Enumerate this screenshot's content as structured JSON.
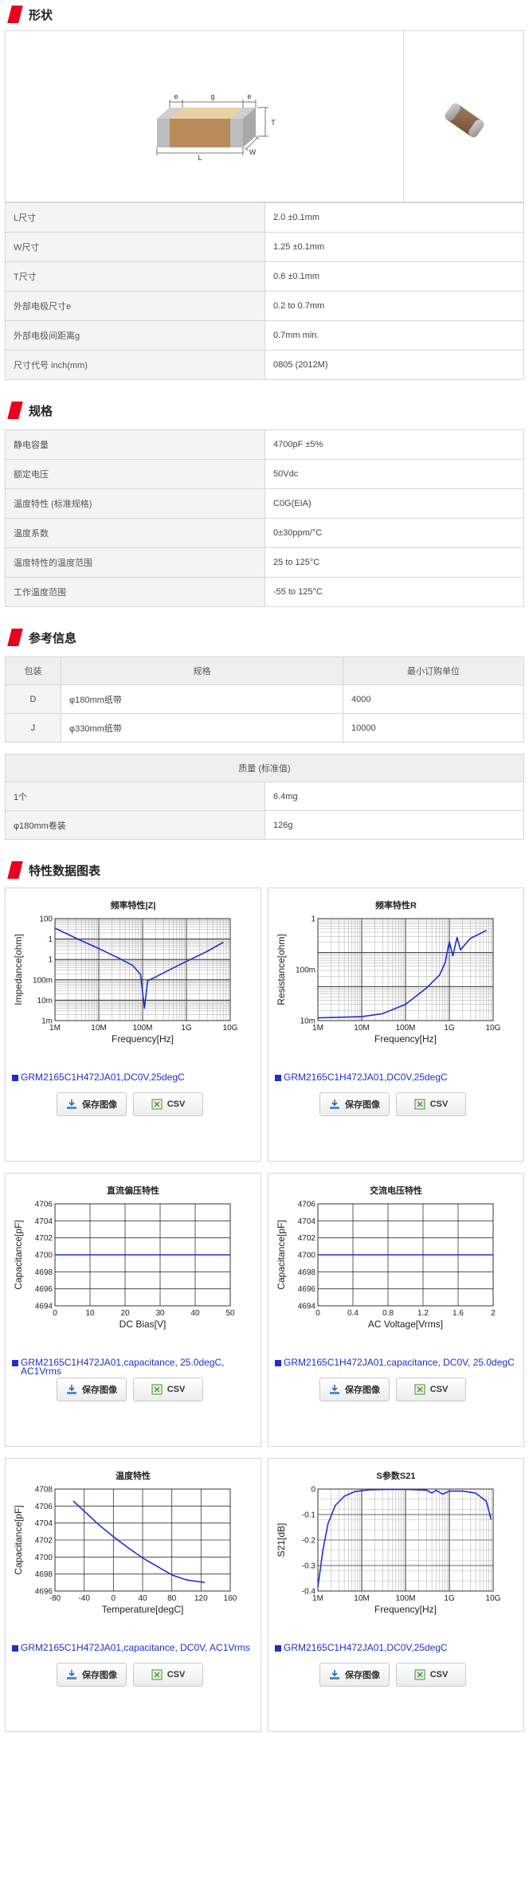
{
  "sections": {
    "shape": "形状",
    "specs": "规格",
    "ref": "参考信息",
    "charts": "特性数据图表"
  },
  "dim_labels": {
    "e": "e",
    "g": "g",
    "t": "T",
    "l": "L",
    "w": "W"
  },
  "shape_table": [
    {
      "k": "L尺寸",
      "v": "2.0 ±0.1mm"
    },
    {
      "k": "W尺寸",
      "v": "1.25 ±0.1mm"
    },
    {
      "k": "T尺寸",
      "v": "0.6 ±0.1mm"
    },
    {
      "k": "外部电极尺寸e",
      "v": "0.2 to 0.7mm"
    },
    {
      "k": "外部电极间距离g",
      "v": "0.7mm min."
    },
    {
      "k": "尺寸代号 inch(mm)",
      "v": "0805 (2012M)"
    }
  ],
  "spec_table": [
    {
      "k": "静电容量",
      "v": "4700pF ±5%"
    },
    {
      "k": "额定电压",
      "v": "50Vdc"
    },
    {
      "k": "温度特性 (标准规格)",
      "v": "C0G(EIA)"
    },
    {
      "k": "温度系数",
      "v": "0±30ppm/°C"
    },
    {
      "k": "温度特性的温度范围",
      "v": "25 to 125°C"
    },
    {
      "k": "工作温度范围",
      "v": "-55 to 125°C"
    }
  ],
  "ref_table": {
    "headers": [
      "包装",
      "规格",
      "最小订购单位"
    ],
    "rows": [
      [
        "D",
        "φ180mm纸带",
        "4000"
      ],
      [
        "J",
        "φ330mm纸带",
        "10000"
      ]
    ]
  },
  "mass_table": {
    "header": "质量 (标准值)",
    "rows": [
      {
        "k": "1个",
        "v": "6.4mg"
      },
      {
        "k": "φ180mm卷装",
        "v": "126g"
      }
    ]
  },
  "buttons": {
    "save": "保存图像",
    "csv": "CSV"
  },
  "colors": {
    "accent": "#e8001d",
    "series": "#1f2fd0"
  },
  "chart_data": [
    {
      "type": "line",
      "title": "频率特性|Z|",
      "xlabel": "Frequency[Hz]",
      "ylabel": "Impedance[ohm]",
      "x_scale": "log",
      "y_scale": "log",
      "xlim": [
        1000000,
        10000000000
      ],
      "ylim": [
        0.001,
        100
      ],
      "x_ticks": [
        "1M",
        "10M",
        "100M",
        "1G",
        "10G"
      ],
      "y_ticks": [
        "100",
        "1",
        "1",
        "100m",
        "10m",
        "1m"
      ],
      "legend": "GRM2165C1H472JA01,DC0V,25degC",
      "series": [
        {
          "name": "GRM2165C1H472JA01,DC0V,25degC",
          "x": [
            1000000,
            3000000,
            10000000,
            30000000,
            60000000,
            90000000,
            110000000,
            130000000,
            200000000,
            400000000,
            1000000000,
            3000000000,
            7000000000
          ],
          "y": [
            34,
            11,
            3.4,
            1.1,
            0.5,
            0.18,
            0.004,
            0.09,
            0.14,
            0.3,
            0.8,
            2.5,
            7
          ]
        }
      ]
    },
    {
      "type": "line",
      "title": "频率特性R",
      "xlabel": "Frequency[Hz]",
      "ylabel": "Resistance[ohm]",
      "x_scale": "log",
      "y_scale": "log",
      "xlim": [
        1000000,
        10000000000
      ],
      "ylim": [
        0.01,
        10
      ],
      "x_ticks": [
        "1M",
        "10M",
        "100M",
        "1G",
        "10G"
      ],
      "y_ticks": [
        "1",
        "100m",
        "10m"
      ],
      "legend": "GRM2165C1H472JA01,DC0V,25degC",
      "series": [
        {
          "name": "GRM2165C1H472JA01,DC0V,25degC",
          "x": [
            1000000,
            10000000,
            30000000,
            100000000,
            300000000,
            600000000,
            800000000,
            1000000000,
            1200000000,
            1500000000,
            1800000000,
            3000000000,
            7000000000
          ],
          "y": [
            0.012,
            0.013,
            0.016,
            0.03,
            0.09,
            0.22,
            0.5,
            2.1,
            0.8,
            2.8,
            1.2,
            2.6,
            4.5
          ]
        }
      ]
    },
    {
      "type": "line",
      "title": "直流偏压特性",
      "xlabel": "DC Bias[V]",
      "ylabel": "Capacitance[pF]",
      "xlim": [
        0,
        50
      ],
      "ylim": [
        4694,
        4706
      ],
      "x_ticks": [
        "0",
        "10",
        "20",
        "30",
        "40",
        "50"
      ],
      "y_ticks": [
        "4706",
        "4704",
        "4702",
        "4700",
        "4698",
        "4696",
        "4694"
      ],
      "legend": "GRM2165C1H472JA01,capacitance, 25.0degC, AC1Vrms",
      "series": [
        {
          "name": "GRM2165C1H472JA01,capacitance, 25.0degC, AC1Vrms",
          "x": [
            0,
            50
          ],
          "y": [
            4700,
            4700
          ]
        }
      ]
    },
    {
      "type": "line",
      "title": "交流电压特性",
      "xlabel": "AC Voltage[Vrms]",
      "ylabel": "Capacitance[pF]",
      "xlim": [
        0,
        2
      ],
      "ylim": [
        4694,
        4706
      ],
      "x_ticks": [
        "0",
        "0.4",
        "0.8",
        "1.2",
        "1.6",
        "2"
      ],
      "y_ticks": [
        "4706",
        "4704",
        "4702",
        "4700",
        "4698",
        "4696",
        "4694"
      ],
      "legend": "GRM2165C1H472JA01,capacitance, DC0V, 25.0degC",
      "series": [
        {
          "name": "GRM2165C1H472JA01,capacitance, DC0V, 25.0degC",
          "x": [
            0,
            2
          ],
          "y": [
            4700,
            4700
          ]
        }
      ]
    },
    {
      "type": "line",
      "title": "温度特性",
      "xlabel": "Temperature[degC]",
      "ylabel": "Capacitance[pF]",
      "xlim": [
        -80,
        160
      ],
      "ylim": [
        4696,
        4708
      ],
      "x_ticks": [
        "-80",
        "-40",
        "0",
        "40",
        "80",
        "120",
        "160"
      ],
      "y_ticks": [
        "4708",
        "4706",
        "4704",
        "4702",
        "4700",
        "4698",
        "4696"
      ],
      "legend": "GRM2165C1H472JA01,capacitance, DC0V, AC1Vrms",
      "series": [
        {
          "name": "GRM2165C1H472JA01,capacitance, DC0V, AC1Vrms",
          "x": [
            -55,
            -40,
            -20,
            0,
            20,
            40,
            60,
            80,
            100,
            125
          ],
          "y": [
            4706.6,
            4705.4,
            4703.8,
            4702.4,
            4701.1,
            4699.9,
            4698.9,
            4697.9,
            4697.3,
            4697.0
          ]
        }
      ]
    },
    {
      "type": "line",
      "title": "S参数S21",
      "xlabel": "Frequency[Hz]",
      "ylabel": "S21[dB]",
      "x_scale": "log",
      "xlim": [
        1000000,
        10000000000
      ],
      "ylim": [
        -0.5,
        0
      ],
      "x_ticks": [
        "1M",
        "10M",
        "100M",
        "1G",
        "10G"
      ],
      "y_ticks": [
        "0",
        "-0.1",
        "-0.2",
        "-0.3",
        "-0.4"
      ],
      "legend": "GRM2165C1H472JA01,DC0V,25degC",
      "series": [
        {
          "name": "GRM2165C1H472JA01,DC0V,25degC",
          "x": [
            1000000,
            1300000,
            1700000,
            2500000,
            4000000,
            7000000,
            15000000,
            40000000,
            100000000,
            300000000,
            400000000,
            500000000,
            700000000,
            1000000000,
            2000000000,
            4000000000,
            7000000000,
            9000000000
          ],
          "y": [
            -0.48,
            -0.3,
            -0.17,
            -0.08,
            -0.035,
            -0.012,
            -0.004,
            -0.002,
            -0.002,
            -0.005,
            -0.02,
            -0.006,
            -0.025,
            -0.01,
            -0.01,
            -0.02,
            -0.06,
            -0.15
          ]
        }
      ]
    }
  ]
}
